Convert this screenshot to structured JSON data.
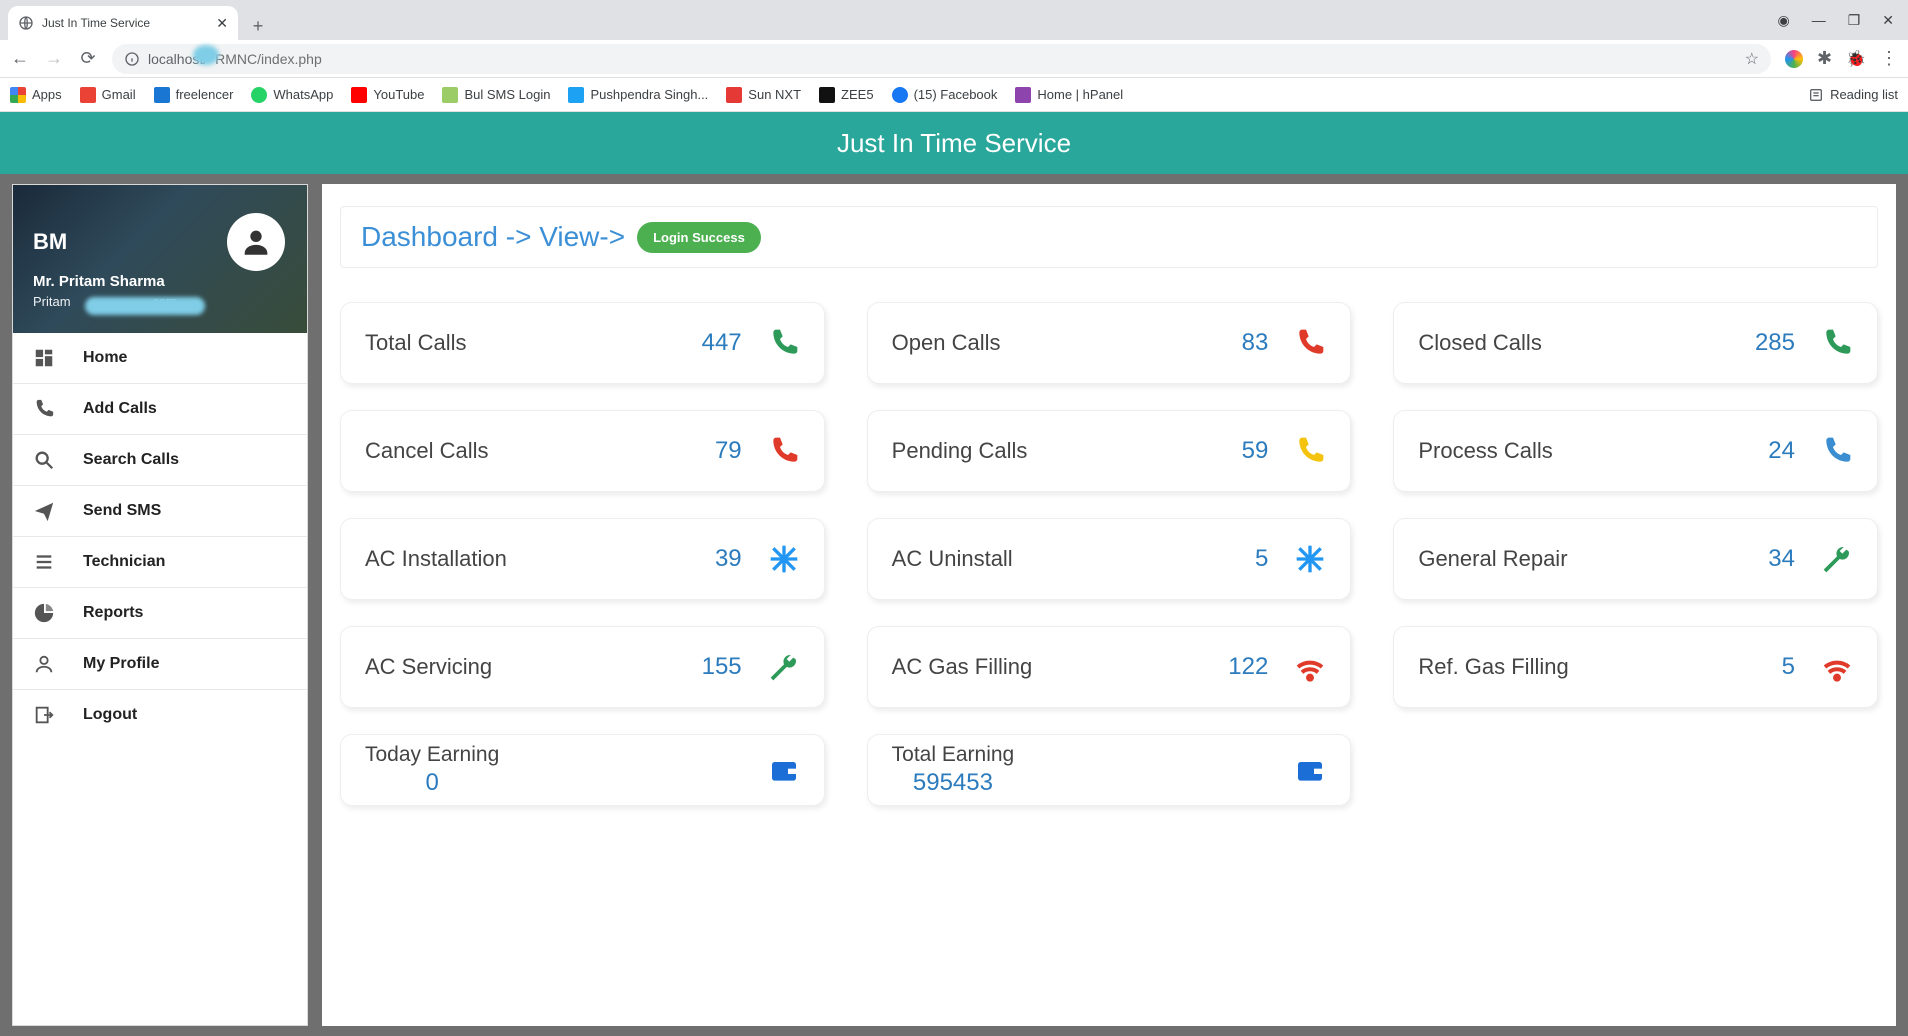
{
  "browser": {
    "tab_title": "Just In Time Service",
    "url_host": "localhost/",
    "url_path": "RMNC/index.php",
    "reading_list": "Reading list"
  },
  "bookmarks": [
    {
      "label": "Apps"
    },
    {
      "label": "Gmail"
    },
    {
      "label": "freelencer"
    },
    {
      "label": "WhatsApp"
    },
    {
      "label": "YouTube"
    },
    {
      "label": "Bul SMS Login"
    },
    {
      "label": "Pushpendra Singh..."
    },
    {
      "label": "Sun NXT"
    },
    {
      "label": "ZEE5"
    },
    {
      "label": "(15) Facebook"
    },
    {
      "label": "Home | hPanel"
    }
  ],
  "app": {
    "title": "Just In Time Service"
  },
  "profile": {
    "role": "BM",
    "name": "Mr. Pritam Sharma",
    "email_prefix": "Pritam",
    "email_suffix": ".com"
  },
  "nav": {
    "home": "Home",
    "add_calls": "Add Calls",
    "search_calls": "Search Calls",
    "send_sms": "Send SMS",
    "technician": "Technician",
    "reports": "Reports",
    "my_profile": "My Profile",
    "logout": "Logout"
  },
  "breadcrumb": {
    "text": "Dashboard -> View->",
    "badge": "Login Success"
  },
  "cards": {
    "total_calls": {
      "label": "Total Calls",
      "value": "447",
      "icon": "phone",
      "color": "c-green"
    },
    "open_calls": {
      "label": "Open Calls",
      "value": "83",
      "icon": "phone",
      "color": "c-red"
    },
    "closed_calls": {
      "label": "Closed Calls",
      "value": "285",
      "icon": "phone",
      "color": "c-green"
    },
    "cancel_calls": {
      "label": "Cancel Calls",
      "value": "79",
      "icon": "phone",
      "color": "c-red"
    },
    "pending_calls": {
      "label": "Pending Calls",
      "value": "59",
      "icon": "phone",
      "color": "c-yellow"
    },
    "process_calls": {
      "label": "Process Calls",
      "value": "24",
      "icon": "phone",
      "color": "c-blue"
    },
    "ac_install": {
      "label": "AC Installation",
      "value": "39",
      "icon": "snow",
      "color": "c-sky"
    },
    "ac_uninstall": {
      "label": "AC Uninstall",
      "value": "5",
      "icon": "snow",
      "color": "c-sky"
    },
    "gen_repair": {
      "label": "General Repair",
      "value": "34",
      "icon": "wrench",
      "color": "c-green"
    },
    "ac_servicing": {
      "label": "AC Servicing",
      "value": "155",
      "icon": "wrench",
      "color": "c-green"
    },
    "ac_gas": {
      "label": "AC Gas Filling",
      "value": "122",
      "icon": "signal",
      "color": "c-red"
    },
    "ref_gas": {
      "label": "Ref. Gas Filling",
      "value": "5",
      "icon": "signal",
      "color": "c-red"
    },
    "today_earn": {
      "label": "Today Earning",
      "value": "0",
      "icon": "wallet",
      "color": "c-bblue"
    },
    "total_earn": {
      "label": "Total Earning",
      "value": "595453",
      "icon": "wallet",
      "color": "c-bblue"
    }
  }
}
